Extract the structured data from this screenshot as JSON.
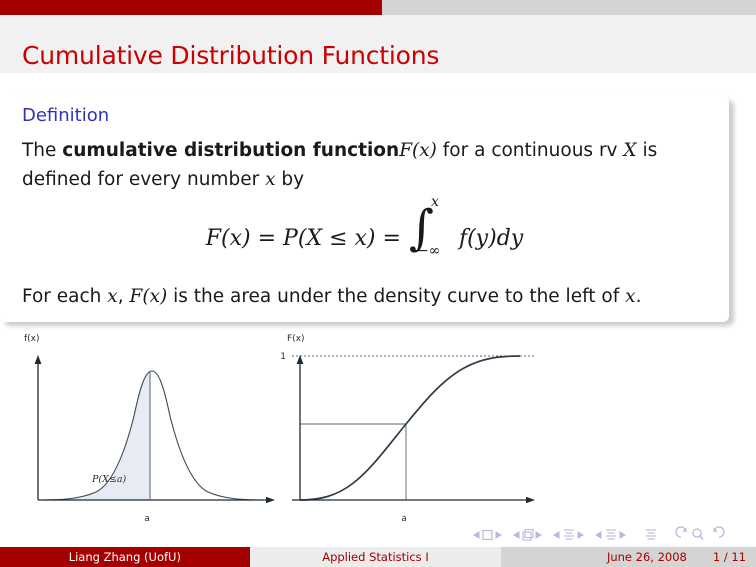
{
  "slide": {
    "title": "Cumulative Distribution Functions"
  },
  "definition": {
    "heading": "Definition",
    "line1_pre": "The ",
    "line1_bold": "cumulative distribution function",
    "line1_fx": "F(x)",
    "line1_mid": " for a continuous rv ",
    "line1_X": "X",
    "line1_post": " is defined for every number ",
    "line1_x": "x",
    "line1_end": " by",
    "formula": {
      "lhs": "F(x) = P(X ≤ x) =",
      "integral_symbol": "∫",
      "upper_limit": "x",
      "lower_limit": "−∞",
      "integrand": "f(y)dy",
      "full_text": "F(x) = P(X ≤ x) = ∫_{−∞}^{x} f(y)dy"
    },
    "tail_pre": "For each ",
    "tail_x1": "x",
    "tail_mid": ", ",
    "tail_Fx": "F(x)",
    "tail_post": " is the area under the density curve to the left of ",
    "tail_x2": "x",
    "tail_end": "."
  },
  "figures": {
    "left": {
      "name": "density-curve-figure",
      "y_axis_label": "f(x)",
      "x_tick_label": "a",
      "area_label": "P(X≤a)",
      "shaded_fill": "#e8eaf4",
      "curve_color": "#2f3b47",
      "axis_color": "#1c2b36",
      "description": "Normal density curve with area to the left of a shaded"
    },
    "right": {
      "name": "cdf-curve-figure",
      "y_axis_label": "F(x)",
      "x_tick_label": "a",
      "y_tick_label": "1",
      "curve_color": "#2f3b47",
      "axis_color": "#1c2b36",
      "description": "S-shaped cumulative distribution function approaching 1"
    }
  },
  "nav_symbols": [
    "slide-first-icon",
    "slide-prev-icon",
    "frame-icon",
    "frame-next-icon",
    "subsection-prev-icon",
    "subsection-icon",
    "subsection-next-icon",
    "section-prev-icon",
    "section-icon",
    "section-next-icon",
    "doc-icon",
    "back-icon",
    "search-icon",
    "forward-icon"
  ],
  "footer": {
    "author": "Liang Zhang  (UofU)",
    "course": "Applied Statistics I",
    "date": "June 26, 2008",
    "page": "1 / 11"
  },
  "colors": {
    "brand_red": "#a50000",
    "title_red": "#cc0000",
    "heading_blue": "#3333b2",
    "bar_gray": "#d4d4d4",
    "title_band": "#f1f1f1",
    "nav_lavender": "#b9b9dd"
  }
}
